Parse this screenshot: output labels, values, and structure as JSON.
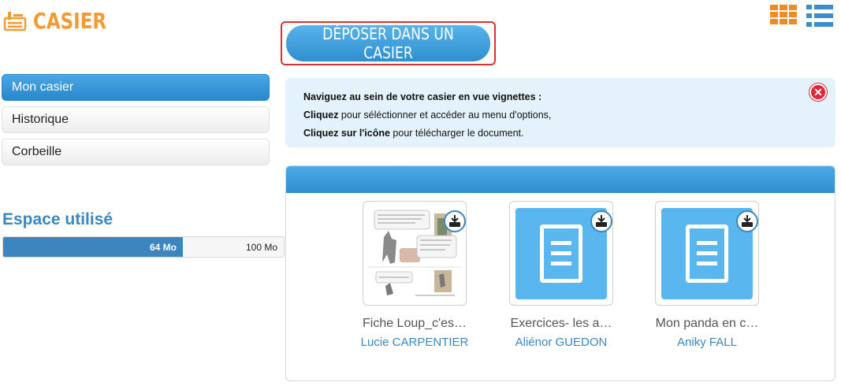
{
  "brand": {
    "title": "CASIER",
    "logo_icon": "locker-icon",
    "color": "#f39a32"
  },
  "view_toggle": {
    "grid_icon": "grid-view-icon",
    "list_icon": "list-view-icon"
  },
  "deposit": {
    "label": "DÉPOSER DANS UN CASIER",
    "highlight_color": "#d93030"
  },
  "sidebar": {
    "items": [
      {
        "label": "Mon casier",
        "active": true
      },
      {
        "label": "Historique",
        "active": false
      },
      {
        "label": "Corbeille",
        "active": false
      }
    ]
  },
  "usage": {
    "title": "Espace utilisé",
    "used_label": "64 Mo",
    "total_label": "100 Mo",
    "used_fraction": 0.64
  },
  "info": {
    "line1": "Naviguez au sein de votre casier en vue vignettes :",
    "line2_bold": "Cliquez",
    "line2_rest": " pour séléctionner et accéder au menu d'options,",
    "line3_bold": "Cliquez sur l'icône",
    "line3_rest": " pour télécharger le document.",
    "close_icon": "close-icon"
  },
  "files": [
    {
      "name": "Fiche Loup_c'es…",
      "owner": "Lucie CARPENTIER",
      "thumb": "comic-preview"
    },
    {
      "name": "Exercices- les a…",
      "owner": "Aliénor GUEDON",
      "thumb": "document-icon"
    },
    {
      "name": "Mon panda en c…",
      "owner": "Aniky FALL",
      "thumb": "document-icon"
    }
  ],
  "colors": {
    "accent_blue": "#2f8fcf",
    "info_bg": "#e3f2fb"
  }
}
